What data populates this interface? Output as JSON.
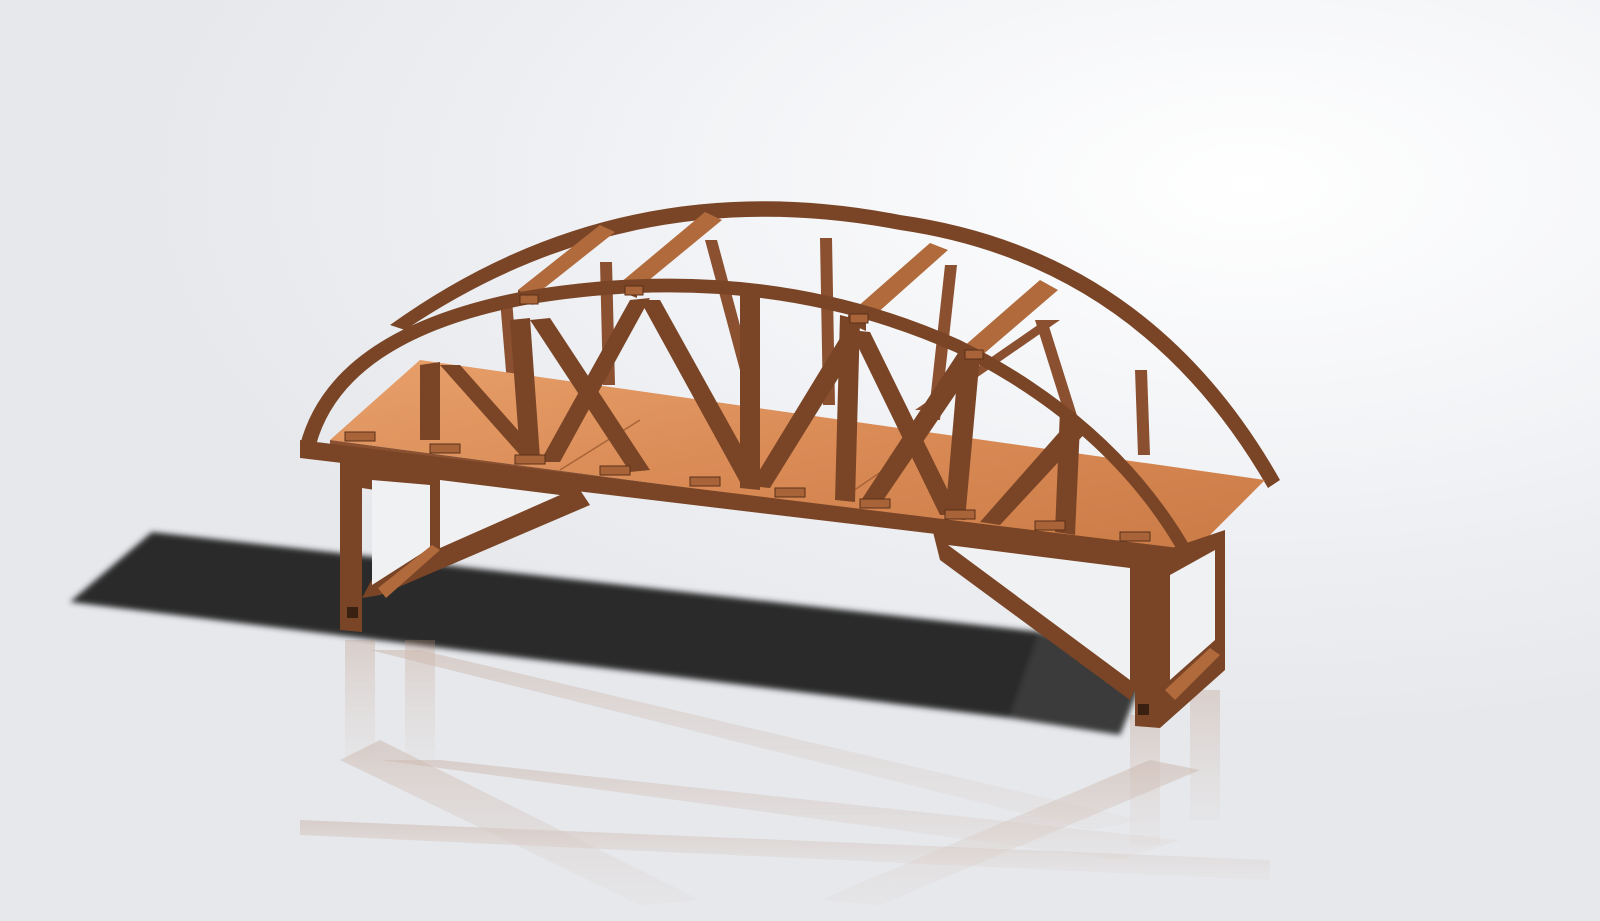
{
  "scene": {
    "subject": "wooden-arch-truss-bridge-model",
    "view": "isometric",
    "colors": {
      "wood_dark": "#7a4526",
      "wood_mid": "#8a5030",
      "wood_light": "#b06a3c",
      "deck": "#d98a55",
      "deck_light": "#e8a06a",
      "shadow": "#2a2a2a",
      "background": "#eceef2"
    }
  }
}
